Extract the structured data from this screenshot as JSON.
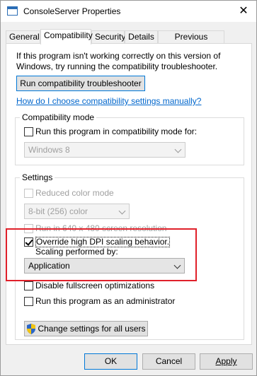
{
  "window": {
    "title": "ConsoleServer Properties",
    "close_glyph": "✕"
  },
  "tabs": [
    {
      "label": "General"
    },
    {
      "label": "Compatibility",
      "active": true
    },
    {
      "label": "Security"
    },
    {
      "label": "Details"
    },
    {
      "label": "Previous Versions"
    }
  ],
  "intro_text": "If this program isn't working correctly on this version of Windows, try running the compatibility troubleshooter.",
  "troubleshooter_button": "Run compatibility troubleshooter",
  "help_link": "How do I choose compatibility settings manually?",
  "compat_mode": {
    "title": "Compatibility mode",
    "checkbox_label": "Run this program in compatibility mode for:",
    "checked": false,
    "os_select": "Windows 8"
  },
  "settings": {
    "title": "Settings",
    "reduced_color": {
      "label": "Reduced color mode",
      "checked": false,
      "disabled": true
    },
    "color_select": "8-bit (256) color",
    "run_640": {
      "label": "Run in 640 x 480 screen resolution",
      "checked": false,
      "disabled": true
    },
    "override_dpi": {
      "label_line1": "Override high DPI scaling behavior.",
      "label_line2": "Scaling performed by:",
      "checked": true
    },
    "scaling_select": "Application",
    "disable_fullscreen": {
      "label": "Disable fullscreen optimizations",
      "checked": false
    },
    "run_admin": {
      "label": "Run this program as an administrator",
      "checked": false
    }
  },
  "change_all_users_button": "Change settings for all users",
  "footer": {
    "ok": "OK",
    "cancel": "Cancel",
    "apply": "Apply"
  },
  "colors": {
    "highlight": "#e0202a",
    "link": "#0066cc",
    "focus": "#0078d7"
  }
}
